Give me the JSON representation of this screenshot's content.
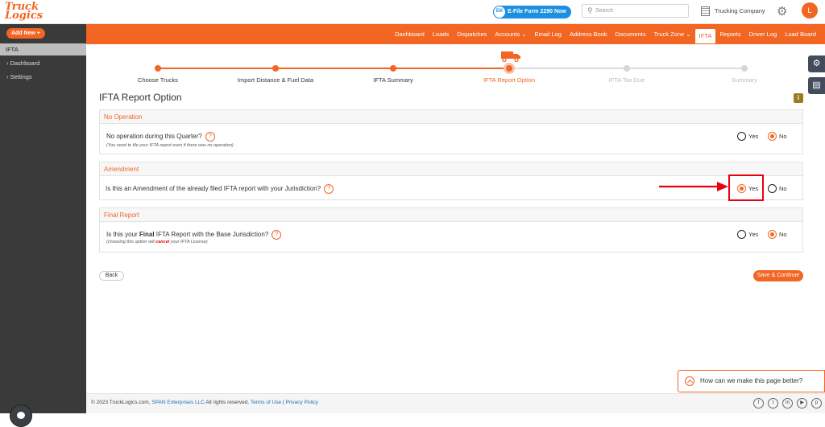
{
  "header": {
    "logo_line1": "Truck",
    "logo_line2": "Logics",
    "efile_badge": "EK",
    "efile_label": "E-File Form 2290 Now",
    "search_placeholder": "Search",
    "company": "Trucking Company",
    "avatar_initial": "L"
  },
  "nav": [
    "Dashboard",
    "Loads",
    "Dispatches",
    "Accounts ⌄",
    "Email Log",
    "Address Book",
    "Documents",
    "Truck Zone ⌄",
    "IFTA",
    "Reports",
    "Driver Log",
    "Load Board"
  ],
  "nav_active": "IFTA",
  "sidebar": {
    "add_new": "Add New +",
    "section": "IFTA",
    "items": [
      "› Dashboard",
      "› Settings"
    ]
  },
  "steps": [
    {
      "label": "Choose Trucks",
      "state": "done"
    },
    {
      "label": "Import Distance & Fuel Data",
      "state": "done"
    },
    {
      "label": "IFTA Summary",
      "state": "done"
    },
    {
      "label": "IFTA Report Option",
      "state": "current"
    },
    {
      "label": "IFTA Tax Due",
      "state": "todo"
    },
    {
      "label": "Summary",
      "state": "todo"
    }
  ],
  "page_title": "IFTA Report Option",
  "info_icon": "i",
  "sections": {
    "no_operation": {
      "header": "No Operation",
      "question": "No operation during this Quarter?",
      "note": "(You need to file your IFTA report even if there was no operation)",
      "yes": "Yes",
      "no": "No",
      "selected": "No"
    },
    "amendment": {
      "header": "Amendment",
      "question": "Is this an Amendment of the already filed IFTA report with your Jurisdiction?",
      "yes": "Yes",
      "no": "No",
      "selected": "Yes"
    },
    "final_report": {
      "header": "Final Report",
      "question_pre": "Is this your ",
      "question_bold": "Final",
      "question_post": " IFTA Report with the Base Jurisdiction?",
      "note_pre": "(choosing this option will ",
      "note_red": "cancel",
      "note_post": " your IFTA License)",
      "yes": "Yes",
      "no": "No",
      "selected": "No"
    }
  },
  "help_glyph": "?",
  "buttons": {
    "back": "Back",
    "save": "Save & Continue"
  },
  "feedback": "How can we make this page better?",
  "footer": {
    "copyright": "© 2023 TruckLogics.com, ",
    "company_link": "SPAN Enterprises LLC",
    "rights": " All rights reserved. ",
    "terms": "Terms of Use",
    "sep": " | ",
    "privacy": "Privacy Policy"
  },
  "social": [
    "f",
    "t",
    "in",
    "▶",
    "p"
  ],
  "colors": {
    "accent": "#f26522",
    "highlight": "#e8000f",
    "efile": "#1c8fe0"
  }
}
